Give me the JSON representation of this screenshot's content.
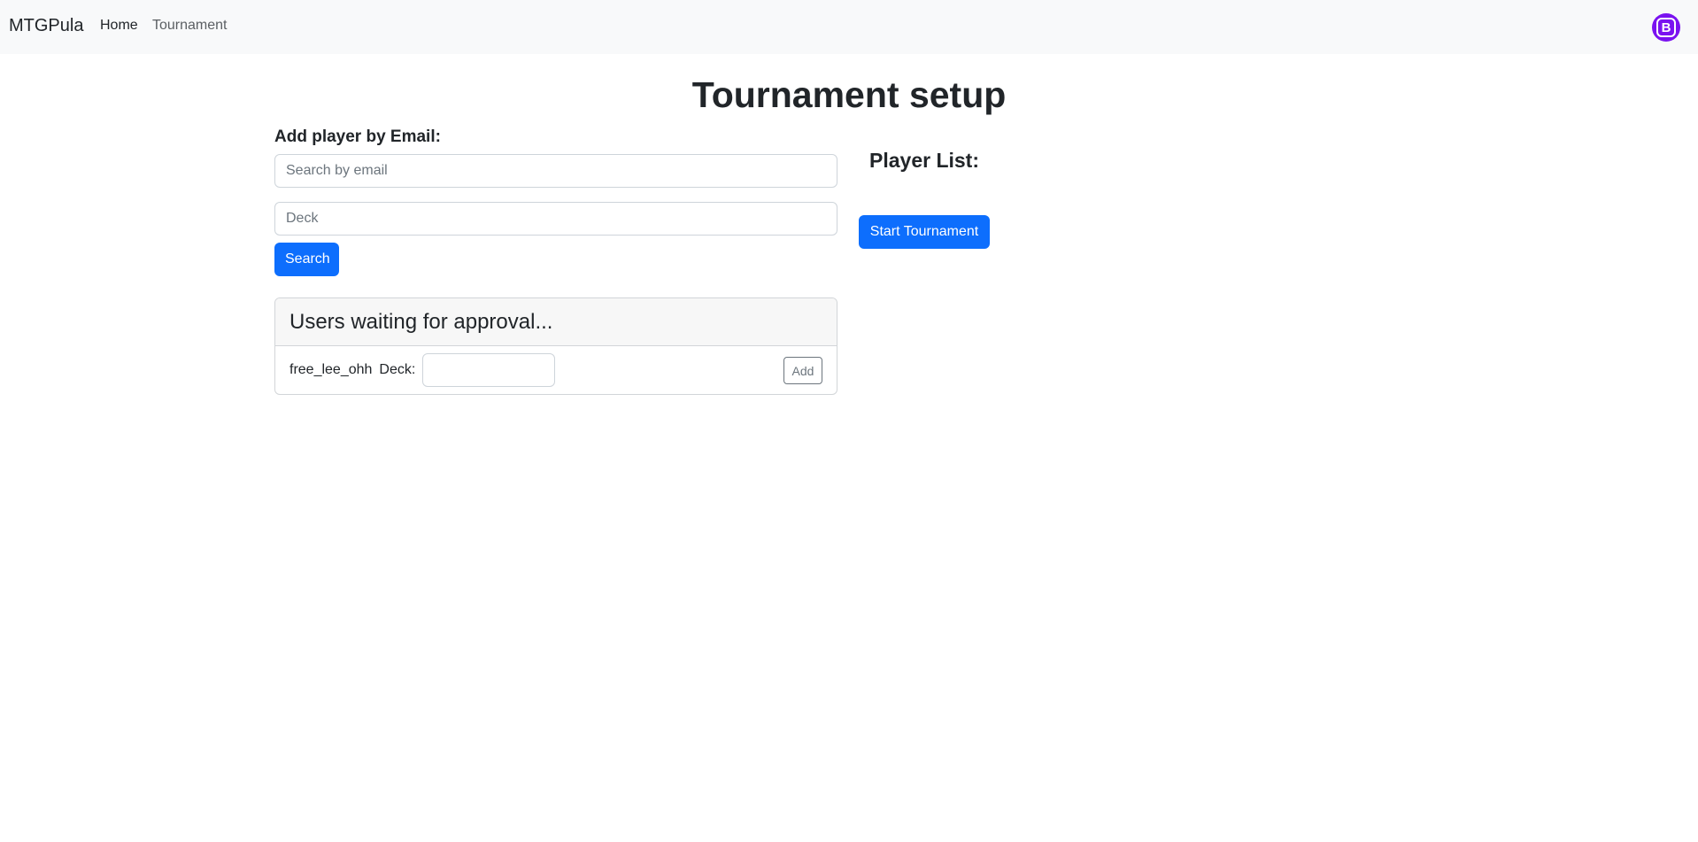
{
  "navbar": {
    "brand": "MTGPula",
    "links": [
      {
        "label": "Home"
      },
      {
        "label": "Tournament"
      }
    ],
    "avatar_letter": "B",
    "avatar_color": "#7a12f0"
  },
  "page": {
    "title": "Tournament setup"
  },
  "add_player": {
    "label": "Add player by Email:",
    "email_placeholder": "Search by email",
    "email_value": "",
    "deck_placeholder": "Deck",
    "deck_value": "",
    "search_button": "Search"
  },
  "player_list": {
    "label": "Player List:",
    "players": [],
    "start_button": "Start Tournament"
  },
  "approval": {
    "title": "Users waiting for approval...",
    "users": [
      {
        "username": "free_lee_ohh",
        "deck_label": "Deck:",
        "deck_value": "",
        "add_button": "Add"
      }
    ]
  },
  "colors": {
    "primary": "#0d6efd",
    "navbar_bg": "#f8f9fa",
    "text": "#212529"
  }
}
